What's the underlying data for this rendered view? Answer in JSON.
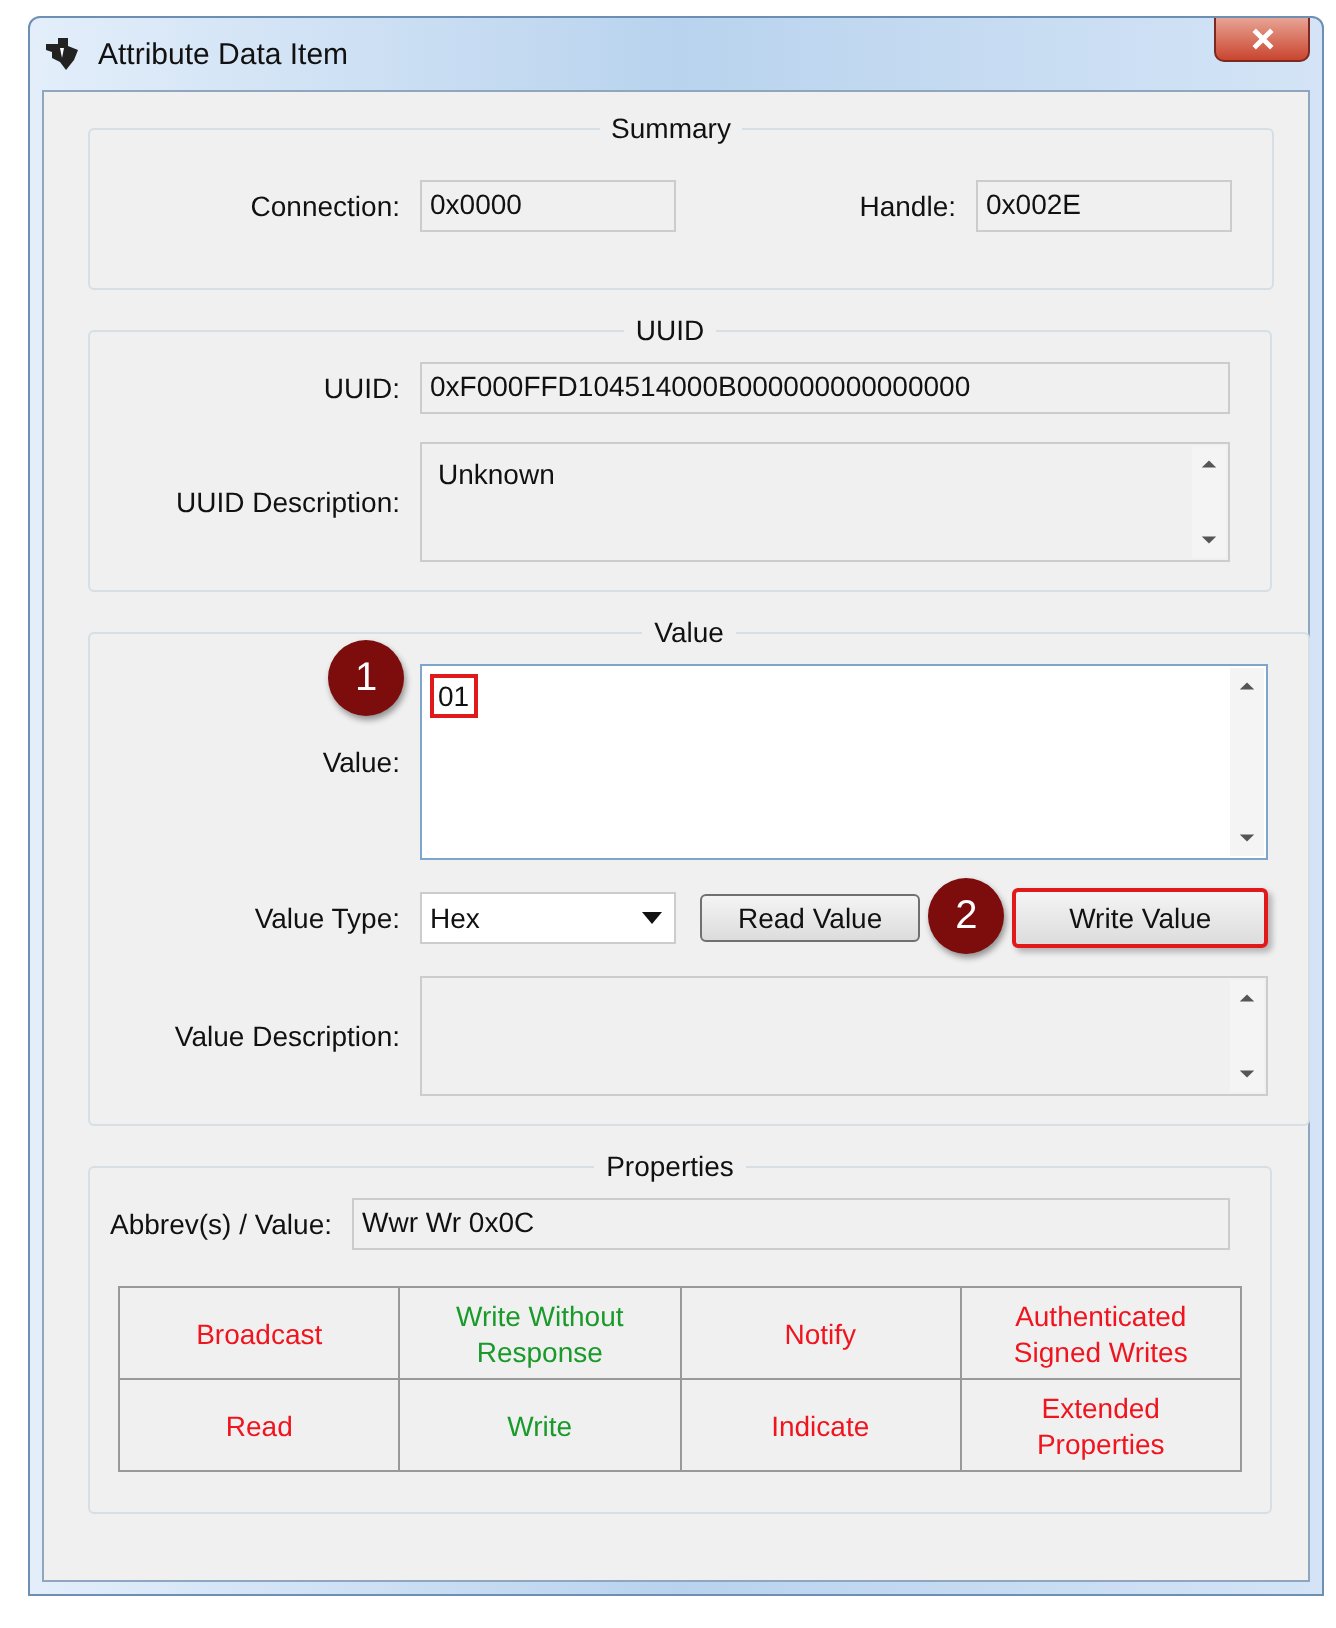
{
  "window": {
    "title": "Attribute Data Item"
  },
  "summary": {
    "title": "Summary",
    "connection_label": "Connection:",
    "connection": "0x0000",
    "handle_label": "Handle:",
    "handle": "0x002E"
  },
  "uuid": {
    "title": "UUID",
    "uuid_label": "UUID:",
    "uuid": "0xF000FFD104514000B000000000000000",
    "description_label": "UUID Description:",
    "description": "Unknown"
  },
  "value": {
    "title": "Value",
    "value_label": "Value:",
    "value": "01",
    "value_highlighted": true,
    "value_callout": "1",
    "type_label": "Value Type:",
    "type": "Hex",
    "read_button": "Read Value",
    "write_button": "Write Value",
    "write_highlighted": true,
    "write_callout": "2",
    "description_label": "Value Description:"
  },
  "properties": {
    "title": "Properties",
    "abbrev_label": "Abbrev(s) / Value:",
    "abbrev": "Wwr Wr  0x0C",
    "flags": [
      {
        "label": "Broadcast",
        "on": false
      },
      {
        "label": "Write Without Response",
        "on": true
      },
      {
        "label": "Notify",
        "on": false
      },
      {
        "label": "Authenticated Signed Writes",
        "on": false
      },
      {
        "label": "Read",
        "on": false
      },
      {
        "label": "Write",
        "on": true
      },
      {
        "label": "Indicate",
        "on": false
      },
      {
        "label": "Extended Properties",
        "on": false
      }
    ]
  }
}
